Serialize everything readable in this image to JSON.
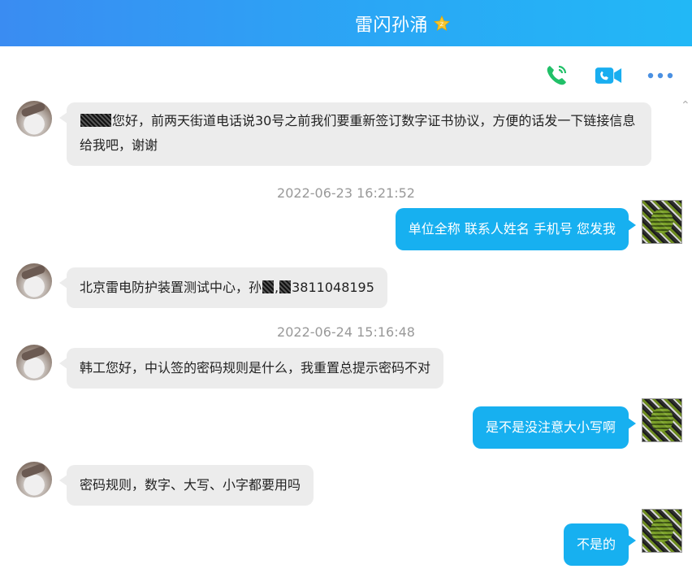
{
  "header": {
    "title": "雷闪孙涌"
  },
  "toolbar": {
    "voice_call_icon": "phone-icon",
    "video_call_icon": "video-icon",
    "more_icon": "more-dots-icon"
  },
  "colors": {
    "header_start": "#3a8cf2",
    "header_end": "#22b8f6",
    "outgoing_bubble": "#17b0f0",
    "incoming_bubble": "#ececec",
    "call_green": "#21c068",
    "video_blue": "#19aef0",
    "more_blue": "#4a90e2"
  },
  "messages": [
    {
      "direction": "in",
      "text": "您好，前两天街道电话说30号之前我们要重新签订数字证书协议，方便的话发一下链接信息给我吧，谢谢"
    },
    {
      "type": "time",
      "text": "2022-06-23 16:21:52"
    },
    {
      "direction": "out",
      "text": "单位全称  联系人姓名 手机号 您发我"
    },
    {
      "direction": "in",
      "text_a": "北京雷电防护装置测试中心，孙",
      "text_b": ",",
      "text_c": "3811048195"
    },
    {
      "type": "time",
      "text": "2022-06-24 15:16:48"
    },
    {
      "direction": "in",
      "text": "韩工您好，中认签的密码规则是什么，我重置总提示密码不对"
    },
    {
      "direction": "out",
      "text": "是不是没注意大小写啊"
    },
    {
      "direction": "in",
      "text": "密码规则，数字、大写、小字都要用吗"
    },
    {
      "direction": "out",
      "text": "不是的"
    }
  ]
}
